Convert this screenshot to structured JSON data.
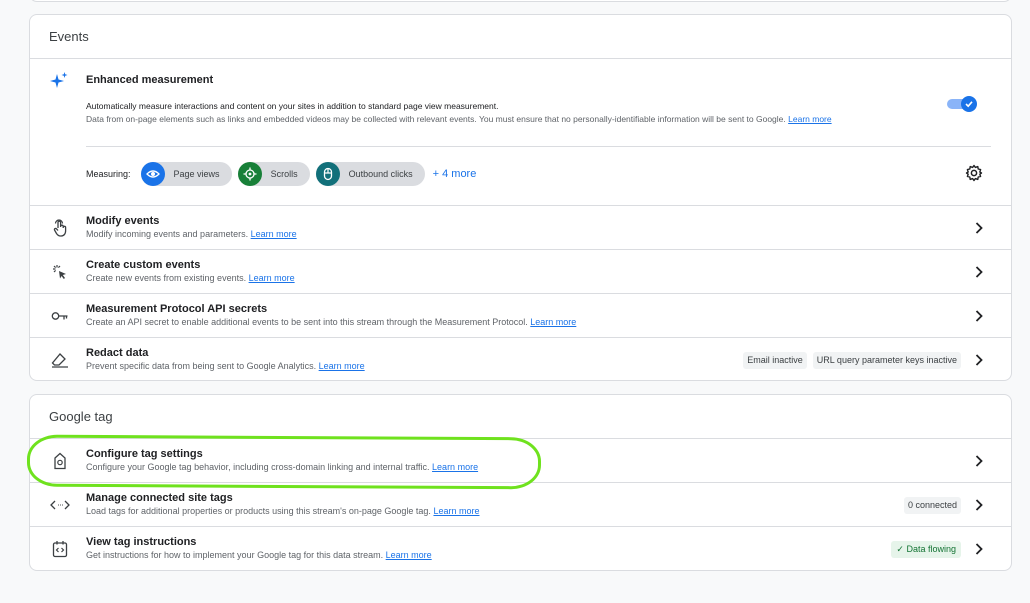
{
  "events": {
    "header": "Events",
    "enhanced": {
      "title": "Enhanced measurement",
      "desc1": "Automatically measure interactions and content on your sites in addition to standard page view measurement.",
      "desc2": "Data from on-page elements such as links and embedded videos may be collected with relevant events. You must ensure that no personally-identifiable information will be sent to Google.",
      "learn_more": "Learn more",
      "toggle_on": true,
      "measuring_label": "Measuring:",
      "pills": [
        {
          "label": "Page views",
          "icon": "eye-icon",
          "color": "#1a73e8"
        },
        {
          "label": "Scrolls",
          "icon": "crosshair-icon",
          "color": "#188038"
        },
        {
          "label": "Outbound clicks",
          "icon": "mouse-icon",
          "color": "#12707a"
        }
      ],
      "more_label": "+ 4 more"
    },
    "rows": [
      {
        "title": "Modify events",
        "desc": "Modify incoming events and parameters.",
        "link": "Learn more",
        "icon": "touch-icon"
      },
      {
        "title": "Create custom events",
        "desc": "Create new events from existing events.",
        "link": "Learn more",
        "icon": "sparkle-cursor-icon"
      },
      {
        "title": "Measurement Protocol API secrets",
        "desc": "Create an API secret to enable additional events to be sent into this stream through the Measurement Protocol.",
        "link": "Learn more",
        "icon": "key-icon"
      },
      {
        "title": "Redact data",
        "desc": "Prevent specific data from being sent to Google Analytics.",
        "link": "Learn more",
        "icon": "eraser-icon",
        "chips": [
          "Email inactive",
          "URL query parameter keys inactive"
        ]
      }
    ]
  },
  "google_tag": {
    "header": "Google tag",
    "rows": [
      {
        "title": "Configure tag settings",
        "desc": "Configure your Google tag behavior, including cross-domain linking and internal traffic.",
        "link": "Learn more",
        "icon": "tag-icon"
      },
      {
        "title": "Manage connected site tags",
        "desc": "Load tags for additional properties or products using this stream's on-page Google tag.",
        "link": "Learn more",
        "icon": "code-arrows-icon",
        "info": "0 connected"
      },
      {
        "title": "View tag instructions",
        "desc": "Get instructions for how to implement your Google tag for this data stream.",
        "link": "Learn more",
        "icon": "instructions-icon",
        "status": "✓ Data flowing"
      }
    ]
  },
  "colors": {
    "accent": "#1a73e8",
    "highlight": "#6fe21e"
  }
}
